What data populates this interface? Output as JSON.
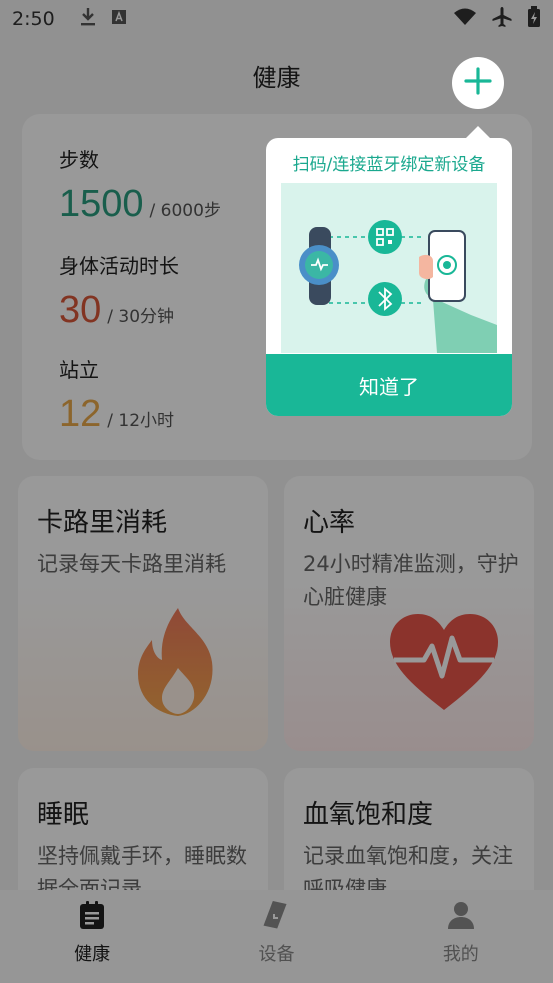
{
  "status_bar": {
    "time": "2:50",
    "icons": [
      "download-icon",
      "font-app-icon",
      "wifi-icon",
      "airplane-mode-icon",
      "battery-charging-icon"
    ]
  },
  "header": {
    "title": "健康",
    "add_icon": "plus-icon"
  },
  "activity": {
    "steps": {
      "label": "步数",
      "value": "1500",
      "goal": "/ 6000步",
      "color": "#2a9d7f"
    },
    "active_time": {
      "label": "身体活动时长",
      "value": "30",
      "goal": "/ 30分钟",
      "color": "#d9583a"
    },
    "standing": {
      "label": "站立",
      "value": "12",
      "goal": "/ 12小时",
      "color": "#e9a94a"
    }
  },
  "features": [
    {
      "title": "卡路里消耗",
      "desc": "记录每天卡路里消耗",
      "icon": "flame-icon"
    },
    {
      "title": "心率",
      "desc": "24小时精准监测，守护心脏健康",
      "icon": "heart-pulse-icon"
    },
    {
      "title": "睡眠",
      "desc": "坚持佩戴手环，睡眠数据全面记录",
      "icon": "moon-icon"
    },
    {
      "title": "血氧饱和度",
      "desc": "记录血氧饱和度，关注呼吸健康",
      "icon": "droplet-icon"
    }
  ],
  "popup": {
    "title": "扫码/连接蓝牙绑定新设备",
    "button": "知道了",
    "illustration": "watch-phone-pairing-illustration",
    "accent": "#19b797"
  },
  "tabs": [
    {
      "label": "健康",
      "icon": "health-clipboard-icon",
      "active": true
    },
    {
      "label": "设备",
      "icon": "band-device-icon",
      "active": false
    },
    {
      "label": "我的",
      "icon": "person-icon",
      "active": false
    }
  ]
}
